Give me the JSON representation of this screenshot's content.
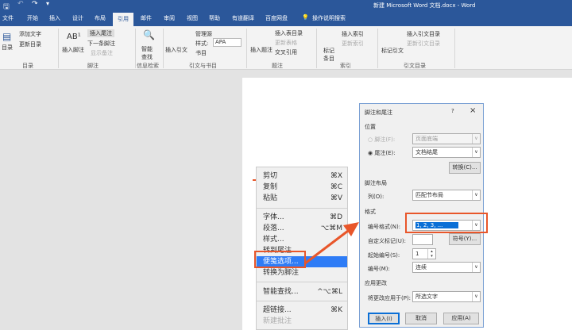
{
  "window": {
    "title": "新建 Microsoft Word 文档.docx - Word"
  },
  "quick_access": {
    "save": "save-icon",
    "undo": "undo-icon",
    "redo": "redo-icon"
  },
  "tabs": [
    {
      "label": "文件"
    },
    {
      "label": "开始"
    },
    {
      "label": "插入"
    },
    {
      "label": "设计"
    },
    {
      "label": "布局"
    },
    {
      "label": "引用",
      "active": true
    },
    {
      "label": "邮件"
    },
    {
      "label": "审阅"
    },
    {
      "label": "视图"
    },
    {
      "label": "帮助"
    },
    {
      "label": "有道翻译"
    },
    {
      "label": "百度网盘"
    }
  ],
  "tell_me": "操作说明搜索",
  "ribbon": {
    "toc": {
      "button": "目录",
      "add_text": "添加文字",
      "update": "更新目录",
      "group": "目录"
    },
    "footnotes": {
      "insert_footnote": "插入脚注",
      "insert_endnote": "插入尾注",
      "next_footnote": "下一条脚注",
      "show_notes": "显示备注",
      "group": "脚注"
    },
    "research": {
      "smart_lookup": "智能查找",
      "group": "信息检索"
    },
    "citations": {
      "insert_citation": "插入引文",
      "manage_sources": "管理源",
      "style_label": "样式:",
      "style_value": "APA",
      "bibliography": "书目",
      "group": "引文与书目"
    },
    "captions": {
      "insert_caption": "插入题注",
      "insert_table_of_figures": "插入表目录",
      "update_table": "更新表格",
      "cross_reference": "交叉引用",
      "group": "题注"
    },
    "index": {
      "mark_entry": "标记条目",
      "insert_index": "插入索引",
      "update_index": "更新索引",
      "group": "索引"
    },
    "toa": {
      "mark_citation": "标记引文",
      "insert_toa": "插入引文目录",
      "update_toa": "更新引文目录",
      "group": "引文目录"
    }
  },
  "context_menu": [
    {
      "label": "剪切",
      "shortcut": "⌘X"
    },
    {
      "label": "复制",
      "shortcut": "⌘C"
    },
    {
      "label": "粘贴",
      "shortcut": "⌘V"
    },
    {
      "label": "字体...",
      "shortcut": "⌘D"
    },
    {
      "label": "段落...",
      "shortcut": "⌥⌘M"
    },
    {
      "label": "样式...",
      "shortcut": ""
    },
    {
      "label": "转到尾注",
      "shortcut": ""
    },
    {
      "label": "便笺选项...",
      "shortcut": "",
      "highlighted": true
    },
    {
      "label": "转换为脚注",
      "shortcut": ""
    },
    {
      "label": "智能查找...",
      "shortcut": "^⌥⌘L"
    },
    {
      "label": "超链接...",
      "shortcut": "⌘K"
    },
    {
      "label": "新建批注",
      "shortcut": "",
      "disabled": true
    }
  ],
  "dialog": {
    "title": "脚注和尾注",
    "help": "?",
    "close": "×",
    "location_heading": "位置",
    "footnote_label": "脚注(F):",
    "footnote_value": "页面底端",
    "endnote_label": "尾注(E):",
    "endnote_value": "文档结尾",
    "endnote_selected": true,
    "convert_button": "转换(C)...",
    "layout_heading": "脚注布局",
    "columns_label": "列(O):",
    "columns_value": "匹配节布局",
    "format_heading": "格式",
    "number_format_label": "编号格式(N):",
    "number_format_value": "1, 2, 3, ...",
    "custom_mark_label": "自定义标记(U):",
    "custom_mark_value": "",
    "symbol_button": "符号(Y)...",
    "start_at_label": "起始编号(S):",
    "start_at_value": "1",
    "numbering_label": "编号(M):",
    "numbering_value": "连续",
    "apply_heading": "应用更改",
    "apply_to_label": "将更改应用于(P):",
    "apply_to_value": "所选文字",
    "insert_button": "插入(I)",
    "cancel_button": "取消",
    "apply_button": "应用(A)"
  },
  "colors": {
    "brand": "#2b579a",
    "highlight": "#2e7cf6",
    "annotation": "#e8562a"
  }
}
